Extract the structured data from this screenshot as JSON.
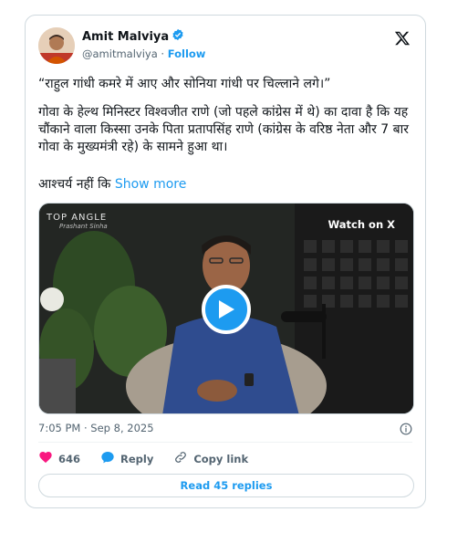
{
  "author": {
    "name": "Amit Malviya",
    "handle": "@amitmalviya",
    "separator": "·",
    "follow_label": "Follow"
  },
  "tweet": {
    "quote": "“राहुल गांधी कमरे में आए और सोनिया गांधी पर चिल्लाने लगे।”",
    "paragraph": "गोवा के हेल्थ मिनिस्टर विश्वजीत राणे (जो पहले कांग्रेस में थे) का दावा है कि यह चौंकाने वाला किस्सा उनके पिता प्रतापसिंह राणे (कांग्रेस के वरिष्ठ नेता और 7 बार गोवा के मुख्यमंत्री रहे) के सामने हुआ था।",
    "truncated_text": "आश्चर्य नहीं कि",
    "show_more_label": "Show more"
  },
  "media": {
    "watch_label": "Watch on X",
    "brand_main": "TOP ANGLE",
    "brand_sub": "Prashant Sinha"
  },
  "timestamp": "7:05 PM · Sep 8, 2025",
  "actions": {
    "like_count": "646",
    "reply_label": "Reply",
    "copy_link_label": "Copy link"
  },
  "read_replies_label": "Read 45 replies",
  "colors": {
    "accent": "#1d9bf0",
    "like": "#f91880",
    "muted": "#536471",
    "border": "#cfd9de"
  }
}
